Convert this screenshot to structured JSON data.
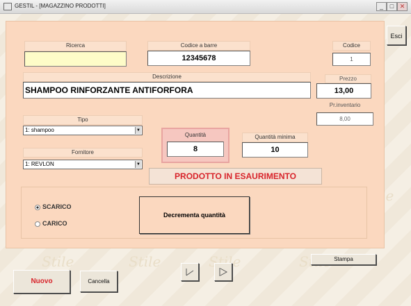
{
  "window": {
    "title": "GESTIL - [MAGAZZINO PRODOTTI]",
    "min": "_",
    "max": "□",
    "close": "✕"
  },
  "watermark": "Stile",
  "exit_label": "Esci",
  "ricerca": {
    "label": "Ricerca",
    "value": ""
  },
  "barcode": {
    "label": "Codice a barre",
    "value": "12345678"
  },
  "codice": {
    "label": "Codice",
    "value": "1"
  },
  "descrizione": {
    "label": "Descrizione",
    "value": "SHAMPOO RINFORZANTE ANTIFORFORA"
  },
  "prezzo": {
    "label": "Prezzo",
    "value": "13,00"
  },
  "prinventario": {
    "label": "Pr.inventario",
    "value": "8,00"
  },
  "tipo": {
    "label": "Tipo",
    "selected": "1: shampoo"
  },
  "fornitore": {
    "label": "Fornitore",
    "selected": "1: REVLON"
  },
  "quantita": {
    "label": "Quantità",
    "value": "8"
  },
  "quantita_minima": {
    "label": "Quantità minima",
    "value": "10"
  },
  "status_message": "PRODOTTO IN ESAURIMENTO",
  "mode": {
    "scarico": "SCARICO",
    "carico": "CARICO",
    "selected": "SCARICO"
  },
  "action_button": "Decrementa quantità",
  "stampa_label": "Stampa",
  "nuovo_label": "Nuovo",
  "cancella_label": "Cancella",
  "nav": {
    "prev_icon": "first-record-icon",
    "next_icon": "next-record-icon"
  },
  "colors": {
    "panel": "#fbd8bf",
    "accent_red": "#d8232a",
    "field_yellow": "#fefcc8"
  }
}
